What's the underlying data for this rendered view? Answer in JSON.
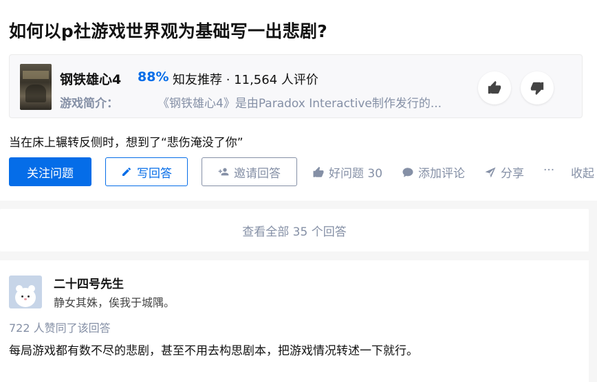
{
  "question": {
    "title": "如何以p社游戏世界观为基础写一出悲剧?",
    "detail": "当在床上辗转反侧时，想到了“悲伤淹没了你”"
  },
  "game": {
    "name": "钢铁雄心4",
    "rating": "88%",
    "rating_label": "知友推荐 · 11,564 人评价",
    "intro_label": "游戏简介：",
    "intro_text": "《钢铁雄心4》是由Paradox Interactive制作发行的..."
  },
  "actions": {
    "follow": "关注问题",
    "write": "写回答",
    "invite": "邀请回答",
    "good_question": "好问题 30",
    "comment": "添加评论",
    "share": "分享",
    "more": "···",
    "collapse": "收起"
  },
  "answers": {
    "view_all": "查看全部 35 个回答"
  },
  "answer": {
    "author": "二十四号先生",
    "bio": "静女其姝，俟我于城隅。",
    "votes": "722 人赞同了该回答",
    "excerpt": "每局游戏都有数不尽的悲剧，甚至不用去构思剧本，把游戏情况转述一下就行。"
  },
  "icons": {
    "upvote": "thumb-up-icon",
    "downvote": "thumb-down-icon",
    "write": "pencil-icon",
    "invite": "add-user-icon",
    "good_question": "thumb-up-icon",
    "comment": "comment-bubble-icon",
    "share": "paper-plane-icon"
  },
  "colors": {
    "brand_blue": "#056de8",
    "muted_gray": "#8590a6",
    "text": "#121212"
  }
}
